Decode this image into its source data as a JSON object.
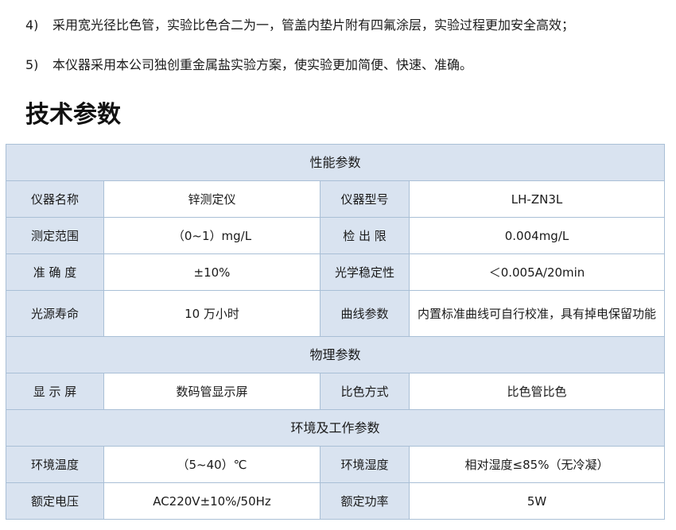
{
  "features": [
    {
      "num": "4)",
      "text": "采用宽光径比色管，实验比色合二为一，管盖内垫片附有四氟涂层，实验过程更加安全高效；"
    },
    {
      "num": "5)",
      "text": "本仪器采用本公司独创重金属盐实验方案，使实验更加简便、快速、准确。"
    }
  ],
  "section_title": "技术参数",
  "table": {
    "groups": [
      {
        "header": "性能参数",
        "rows": [
          {
            "label1": "仪器名称",
            "value1": "锌测定仪",
            "label2": "仪器型号",
            "value2": "LH-ZN3L"
          },
          {
            "label1": "测定范围",
            "value1": "（0~1）mg/L",
            "label2": "检 出 限",
            "value2": "0.004mg/L"
          },
          {
            "label1": "准 确 度",
            "value1": "±10%",
            "label2": "光学稳定性",
            "value2": "＜0.005A/20min"
          },
          {
            "label1": "光源寿命",
            "value1": "10 万小时",
            "label2": "曲线参数",
            "value2": "内置标准曲线可自行校准，具有掉电保留功能"
          }
        ]
      },
      {
        "header": "物理参数",
        "rows": [
          {
            "label1": "显 示 屏",
            "value1": "数码管显示屏",
            "label2": "比色方式",
            "value2": "比色管比色"
          }
        ]
      },
      {
        "header": "环境及工作参数",
        "rows": [
          {
            "label1": "环境温度",
            "value1": "（5~40）℃",
            "label2": "环境湿度",
            "value2": "相对湿度≤85%（无冷凝）"
          },
          {
            "label1": "额定电压",
            "value1": "AC220V±10%/50Hz",
            "label2": "额定功率",
            "value2": "5W"
          }
        ]
      }
    ]
  }
}
